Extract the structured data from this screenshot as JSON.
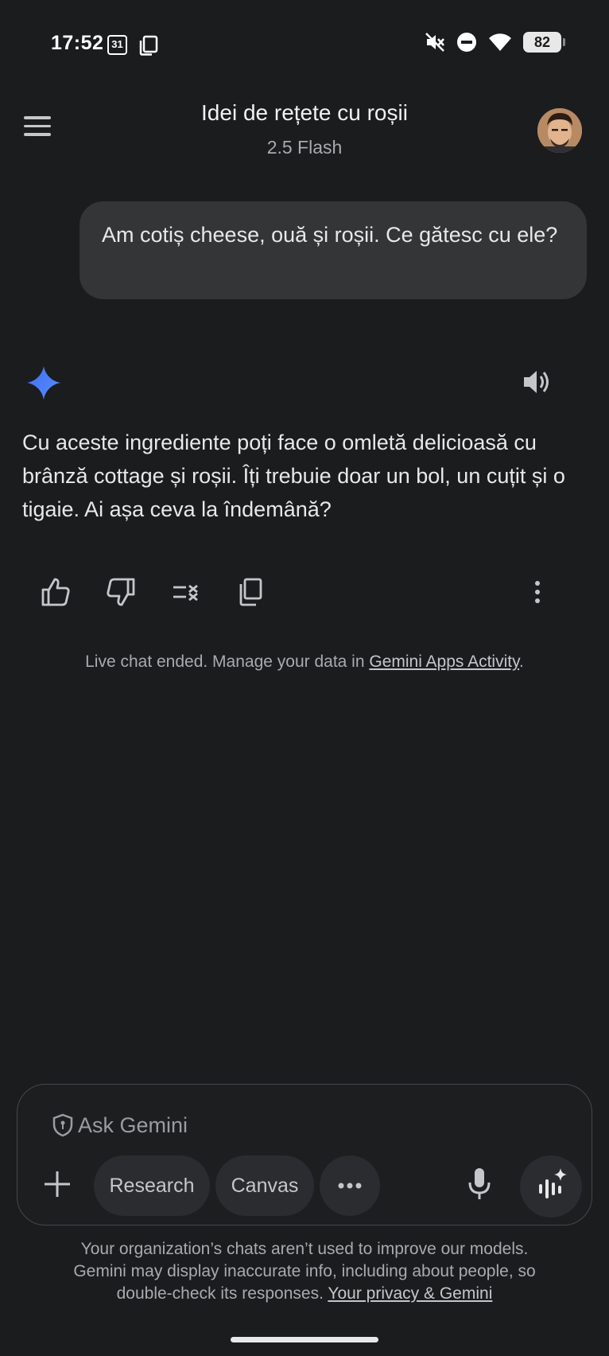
{
  "status_bar": {
    "time": "17:52",
    "calendar_day": "31",
    "battery": "82"
  },
  "header": {
    "title": "Idei de rețete cu roșii",
    "model": "2.5 Flash"
  },
  "user_message": "Am cotiș cheese, ouă și roșii. Ce gătesc cu ele?",
  "response": "Cu aceste ingrediente poți face o omletă delicioasă cu brânză cottage și roșii. Îți trebuie doar un bol, un cuțit și o tigaie. Ai așa ceva la îndemână?",
  "notice": {
    "text": "Live chat ended. Manage your data in ",
    "link": "Gemini Apps Activity",
    "suffix": "."
  },
  "input": {
    "placeholder": "Ask Gemini",
    "chips": [
      "Research",
      "Canvas"
    ]
  },
  "disclaimer": {
    "line1": "Your organization’s chats aren’t used to improve our models.",
    "line2": "Gemini may display inaccurate info, including about people, so",
    "line3": "double-check its responses. ",
    "link": "Your privacy & Gemini"
  },
  "icons": {
    "status": [
      "calendar-icon",
      "copy-notification-icon",
      "mute-icon",
      "dnd-icon",
      "wifi-icon",
      "battery-icon"
    ],
    "actions": [
      "thumbs-up-icon",
      "thumbs-down-icon",
      "modify-response-icon",
      "copy-icon",
      "more-vert-icon"
    ]
  },
  "colors": {
    "background": "#1b1c1e",
    "bubble": "#333537",
    "gemini_blue": "#4a7cf7"
  }
}
